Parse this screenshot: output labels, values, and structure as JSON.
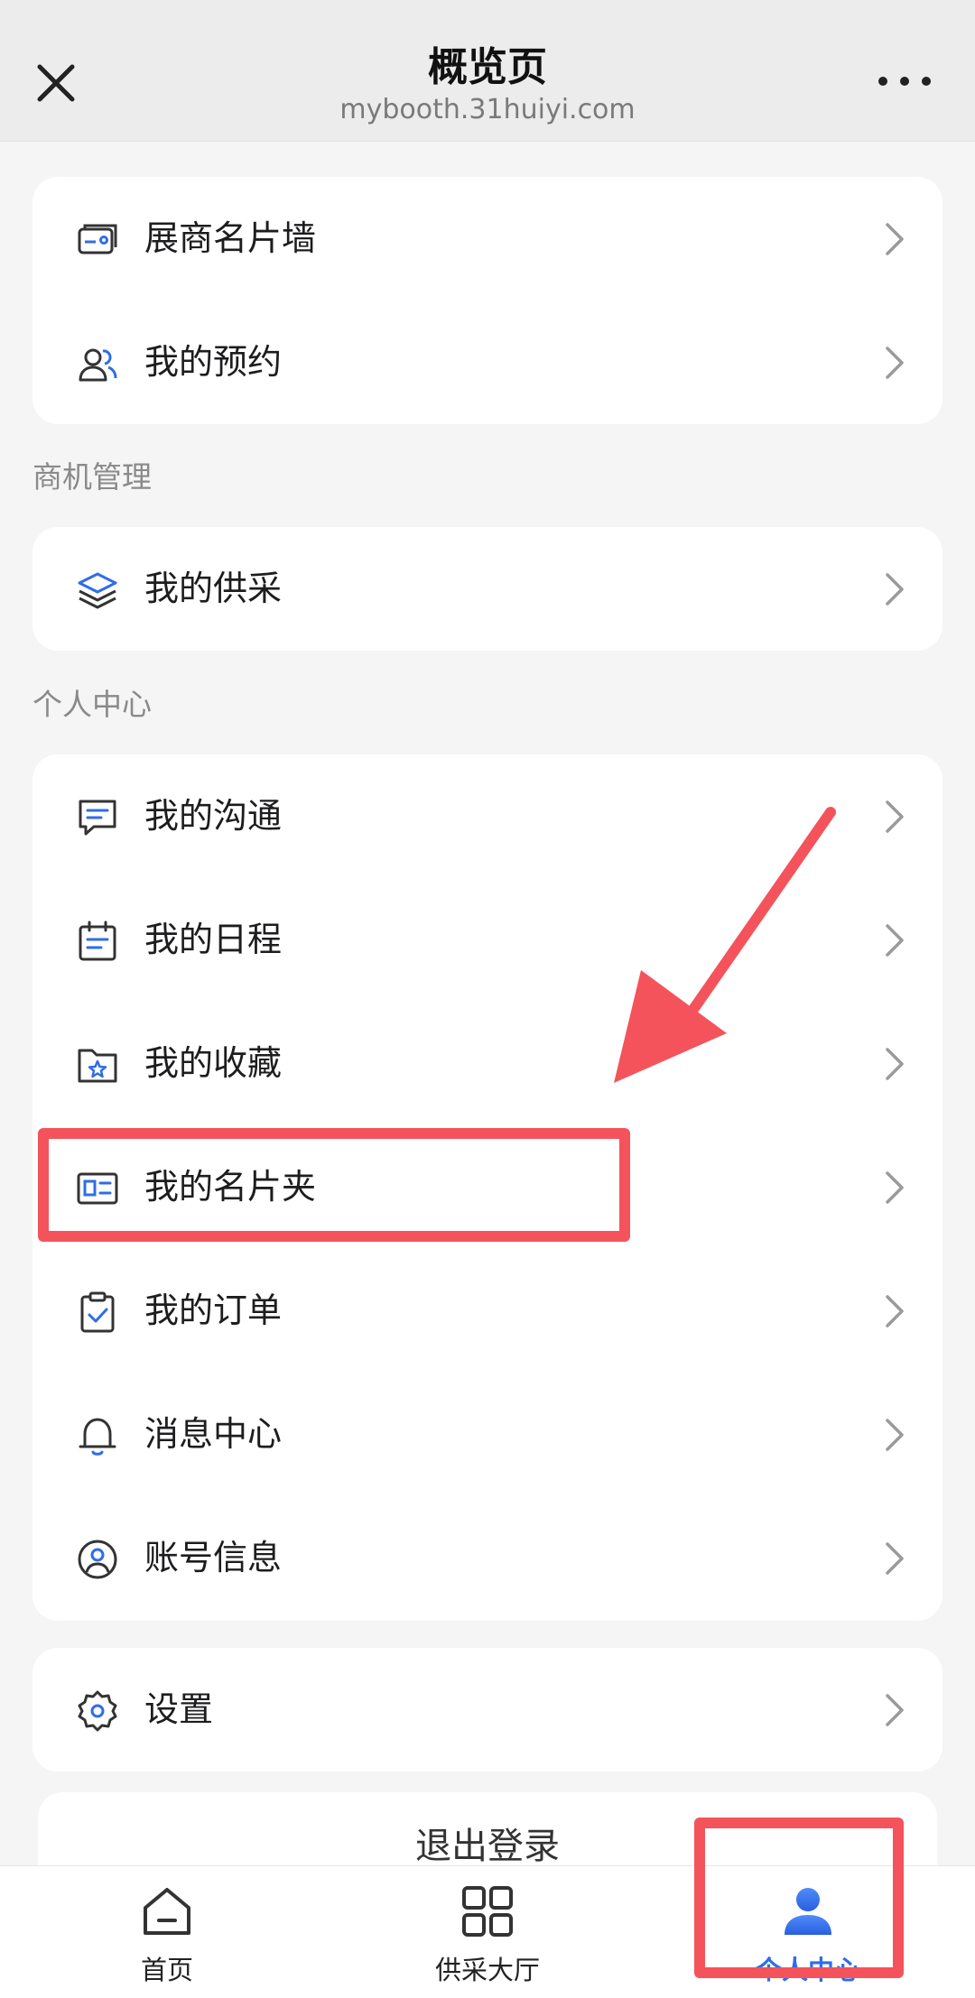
{
  "header": {
    "title": "概览页",
    "url": "mybooth.31huiyi.com",
    "close_icon": "close-icon",
    "more_icon": "more-icon"
  },
  "card1": {
    "items": [
      {
        "label": "展商名片墙",
        "icon": "business-card-wall-icon"
      },
      {
        "label": "我的预约",
        "icon": "users-icon"
      }
    ]
  },
  "section_business": {
    "title": "商机管理",
    "items": [
      {
        "label": "我的供采",
        "icon": "layers-icon"
      }
    ]
  },
  "section_personal": {
    "title": "个人中心",
    "items": [
      {
        "label": "我的沟通",
        "icon": "chat-icon"
      },
      {
        "label": "我的日程",
        "icon": "calendar-icon"
      },
      {
        "label": "我的收藏",
        "icon": "star-folder-icon"
      },
      {
        "label": "我的名片夹",
        "icon": "card-holder-icon"
      },
      {
        "label": "我的订单",
        "icon": "clipboard-check-icon"
      },
      {
        "label": "消息中心",
        "icon": "bell-icon"
      },
      {
        "label": "账号信息",
        "icon": "account-icon"
      }
    ]
  },
  "settings": {
    "label": "设置",
    "icon": "gear-icon"
  },
  "logout": {
    "label": "退出登录"
  },
  "tabbar": {
    "tabs": [
      {
        "label": "首页",
        "icon": "home-icon",
        "active": false
      },
      {
        "label": "供采大厅",
        "icon": "grid-icon",
        "active": false
      },
      {
        "label": "个人中心",
        "icon": "user-icon",
        "active": true
      }
    ]
  },
  "colors": {
    "accent": "#2f6de6",
    "highlight": "#f4535b",
    "background": "#f5f5f5"
  }
}
